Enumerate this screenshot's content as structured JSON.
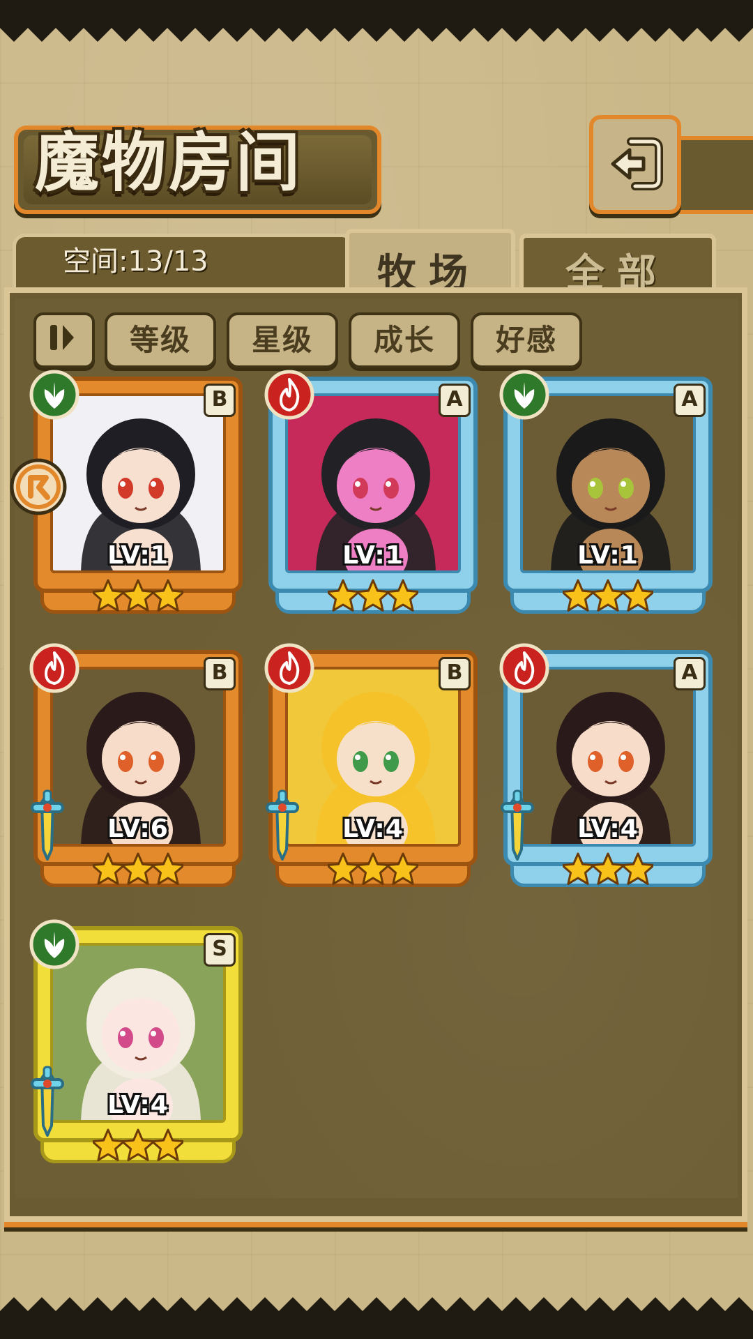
{
  "title": "魔物房间",
  "capacity": {
    "label": "空间:13/13"
  },
  "tabs": [
    {
      "label": "牧场",
      "active": true
    },
    {
      "label": "全部",
      "active": false
    }
  ],
  "sort": {
    "toggle_icon": "pause-icon",
    "buttons": [
      "等级",
      "星级",
      "成长",
      "好感"
    ]
  },
  "monsters": [
    {
      "level": "LV:1",
      "rank": "B",
      "element": "leaf",
      "stars": 3,
      "frame": "orange",
      "weapon": false,
      "hair": "#1e1e24",
      "skin": "#f7e0d0",
      "eyes": "#d23a2a",
      "bg": "#f1f1f5"
    },
    {
      "level": "LV:1",
      "rank": "A",
      "element": "fire",
      "stars": 3,
      "frame": "blue",
      "weapon": false,
      "hair": "#222226",
      "skin": "#ef7fc4",
      "eyes": "#d23a5a",
      "bg": "#c52a5a"
    },
    {
      "level": "LV:1",
      "rank": "A",
      "element": "leaf",
      "stars": 3,
      "frame": "blue",
      "weapon": false,
      "hair": "#1a1a1a",
      "skin": "#b98858",
      "eyes": "#a8c43a",
      "bg": "#6b5c36"
    },
    {
      "level": "LV:6",
      "rank": "B",
      "element": "fire",
      "stars": 3,
      "frame": "orange",
      "weapon": true,
      "hair": "#2a1a1a",
      "skin": "#f7ddc9",
      "eyes": "#e0602a",
      "bg": "#6b5c36"
    },
    {
      "level": "LV:4",
      "rank": "B",
      "element": "fire",
      "stars": 3,
      "frame": "orange",
      "weapon": true,
      "hair": "#f6c22a",
      "skin": "#f7e0c9",
      "eyes": "#3f9a4a",
      "bg": "#f0c83a"
    },
    {
      "level": "LV:4",
      "rank": "A",
      "element": "fire",
      "stars": 3,
      "frame": "blue",
      "weapon": true,
      "hair": "#2a1a1a",
      "skin": "#f7ddc9",
      "eyes": "#e0602a",
      "bg": "#6b5c36"
    },
    {
      "level": "LV:4",
      "rank": "S",
      "element": "leaf",
      "stars": 3,
      "frame": "gold",
      "weapon": true,
      "hair": "#f3ece1",
      "skin": "#fbe6e2",
      "eyes": "#d24a8a",
      "bg": "#8aa35a"
    }
  ],
  "colors": {
    "frame_orange": "#e38a2c",
    "frame_blue": "#8fd0ea",
    "frame_gold": "#f2de3a",
    "element_fire": "#c9221f",
    "element_leaf": "#2f7a2a",
    "star": "#f8c21a",
    "accent_orange": "#e3882a"
  },
  "icons": {
    "back": "back-arrow-icon",
    "lock": "lock-toggle-icon",
    "fire": "fire-element-icon",
    "leaf": "leaf-element-icon",
    "star": "star-icon",
    "sword": "sword-icon"
  }
}
